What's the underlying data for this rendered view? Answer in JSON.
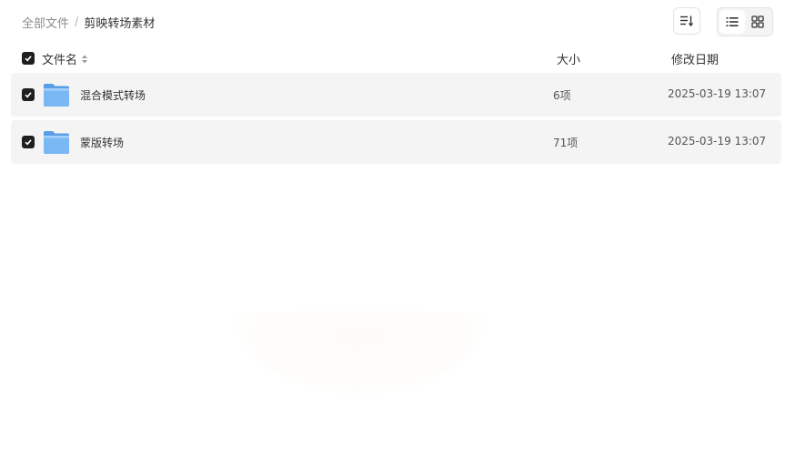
{
  "breadcrumb": {
    "root": "全部文件",
    "separator": "/",
    "current": "剪映转场素材"
  },
  "toolbar": {
    "sort_icon": "sort-icon",
    "list_view_icon": "list-view-icon",
    "grid_view_icon": "grid-view-icon",
    "active_view": "list"
  },
  "table": {
    "columns": {
      "name": "文件名",
      "size": "大小",
      "modified": "修改日期"
    },
    "rows": [
      {
        "name": "混合模式转场",
        "size": "6项",
        "modified": "2025-03-19 13:07",
        "type": "folder",
        "checked": true
      },
      {
        "name": "蒙版转场",
        "size": "71项",
        "modified": "2025-03-19 13:07",
        "type": "folder",
        "checked": true
      }
    ]
  },
  "colors": {
    "row_background": "#f4f4f4",
    "checkbox": "#1f1f1f",
    "folder": "#6fb3f2"
  }
}
